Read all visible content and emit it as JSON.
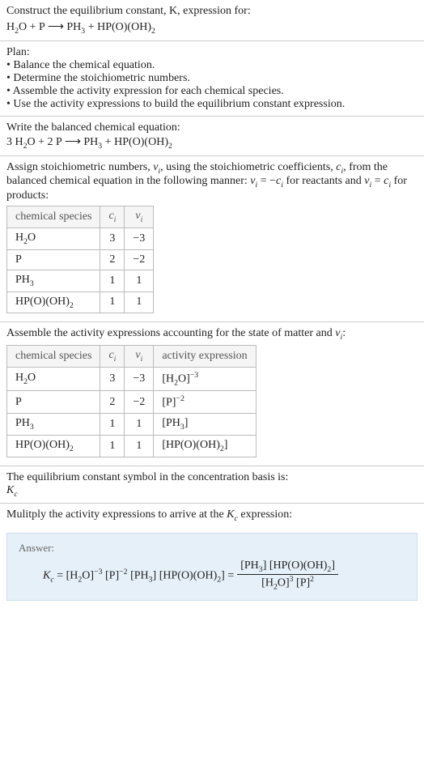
{
  "sec1": {
    "title": "Construct the equilibrium constant, K, expression for:",
    "eq_lhs1": "H",
    "eq_lhs1_sub": "2",
    "eq_lhs2": "O + P ",
    "arrow": "⟶",
    "eq_rhs1": " PH",
    "eq_rhs1_sub": "3",
    "eq_rhs2": " + HP(O)(OH)",
    "eq_rhs2_sub": "2"
  },
  "plan": {
    "title": "Plan:",
    "b1": "• Balance the chemical equation.",
    "b2": "• Determine the stoichiometric numbers.",
    "b3": "• Assemble the activity expression for each chemical species.",
    "b4": "• Use the activity expressions to build the equilibrium constant expression."
  },
  "balanced": {
    "title": "Write the balanced chemical equation:",
    "lhs": "3 H",
    "lhs_sub": "2",
    "lhs2": "O + 2 P ",
    "arrow": "⟶",
    "rhs1": " PH",
    "rhs1_sub": "3",
    "rhs2": " + HP(O)(OH)",
    "rhs2_sub": "2"
  },
  "assign": {
    "p1a": "Assign stoichiometric numbers, ",
    "nu": "ν",
    "i": "i",
    "p1b": ", using the stoichiometric coefficients, ",
    "c": "c",
    "p1c": ", from the balanced chemical equation in the following manner: ",
    "eq1a": " = −",
    "p1d": " for reactants and ",
    "eq2a": " = ",
    "p1e": " for products:"
  },
  "table1": {
    "h1": "chemical species",
    "h2": "c",
    "h2_sub": "i",
    "h3": "ν",
    "h3_sub": "i",
    "rows": [
      {
        "sp_a": "H",
        "sp_sub": "2",
        "sp_b": "O",
        "c": "3",
        "nu": "−3"
      },
      {
        "sp_a": "P",
        "sp_sub": "",
        "sp_b": "",
        "c": "2",
        "nu": "−2"
      },
      {
        "sp_a": "PH",
        "sp_sub": "3",
        "sp_b": "",
        "c": "1",
        "nu": "1"
      },
      {
        "sp_a": "HP(O)(OH)",
        "sp_sub": "2",
        "sp_b": "",
        "c": "1",
        "nu": "1"
      }
    ]
  },
  "assemble": {
    "p1a": "Assemble the activity expressions accounting for the state of matter and ",
    "nu": "ν",
    "i": "i",
    "p1b": ":"
  },
  "table2": {
    "h1": "chemical species",
    "h2": "c",
    "h2_sub": "i",
    "h3": "ν",
    "h3_sub": "i",
    "h4": "activity expression",
    "rows": [
      {
        "sp_a": "H",
        "sp_sub": "2",
        "sp_b": "O",
        "c": "3",
        "nu": "−3",
        "act_a": "[H",
        "act_sub": "2",
        "act_b": "O]",
        "act_sup": "−3"
      },
      {
        "sp_a": "P",
        "sp_sub": "",
        "sp_b": "",
        "c": "2",
        "nu": "−2",
        "act_a": "[P]",
        "act_sub": "",
        "act_b": "",
        "act_sup": "−2"
      },
      {
        "sp_a": "PH",
        "sp_sub": "3",
        "sp_b": "",
        "c": "1",
        "nu": "1",
        "act_a": "[PH",
        "act_sub": "3",
        "act_b": "]",
        "act_sup": ""
      },
      {
        "sp_a": "HP(O)(OH)",
        "sp_sub": "2",
        "sp_b": "",
        "c": "1",
        "nu": "1",
        "act_a": "[HP(O)(OH)",
        "act_sub": "2",
        "act_b": "]",
        "act_sup": ""
      }
    ]
  },
  "symbol": {
    "line1": "The equilibrium constant symbol in the concentration basis is:",
    "K": "K",
    "Ksub": "c"
  },
  "multiply": {
    "line1a": "Mulitply the activity expressions to arrive at the ",
    "K": "K",
    "Ksub": "c",
    "line1b": " expression:"
  },
  "answer": {
    "label": "Answer:",
    "K": "K",
    "Ksub": "c",
    "eq": " = ",
    "t1": "[H",
    "t1_sub": "2",
    "t1b": "O]",
    "t1_sup": "−3",
    "t2": " [P]",
    "t2_sup": "−2",
    "t3": " [PH",
    "t3_sub": "3",
    "t3b": "]",
    "t4": " [HP(O)(OH)",
    "t4_sub": "2",
    "t4b": "] = ",
    "num1": "[PH",
    "num1_sub": "3",
    "num1b": "] [HP(O)(OH)",
    "num1_sub2": "2",
    "num1c": "]",
    "den1": "[H",
    "den1_sub": "2",
    "den1b": "O]",
    "den1_sup": "3",
    "den2": " [P]",
    "den2_sup": "2"
  }
}
